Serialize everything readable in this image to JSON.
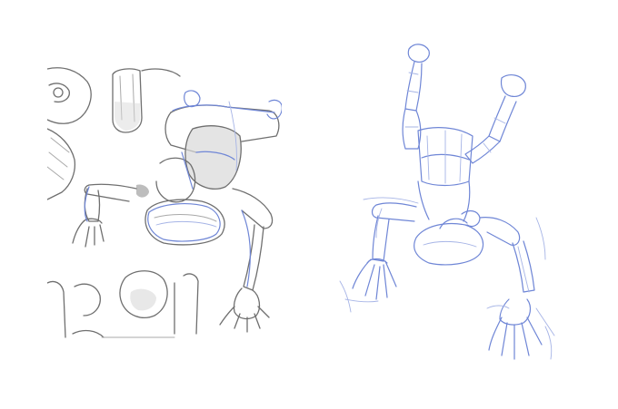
{
  "artwork": {
    "left_panel": "pencil-sketch-with-blue-construction",
    "right_panel": "blue-construction-sketch",
    "colors": {
      "background": "#ffffff",
      "pencil": "#6f6f6f",
      "construction_blue": "#6f86d6"
    }
  }
}
